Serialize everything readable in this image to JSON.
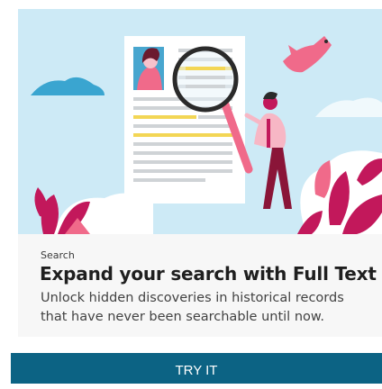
{
  "card": {
    "category": "Search",
    "headline": "Expand your search with Full Text",
    "description": "Unlock hidden discoveries in historical records that have never been searchable until now."
  },
  "cta": {
    "label": "TRY IT"
  },
  "illustration": {
    "icons": [
      "document-icon",
      "magnifier-icon",
      "person-icon",
      "bird-icon",
      "cloud-icon",
      "plant-icon"
    ]
  },
  "colors": {
    "hero_bg": "#cdeaf6",
    "cta_bg": "#0c6384",
    "accent_magenta": "#c2185b",
    "accent_pink": "#f06a8a",
    "highlight_yellow": "#f3d655"
  }
}
